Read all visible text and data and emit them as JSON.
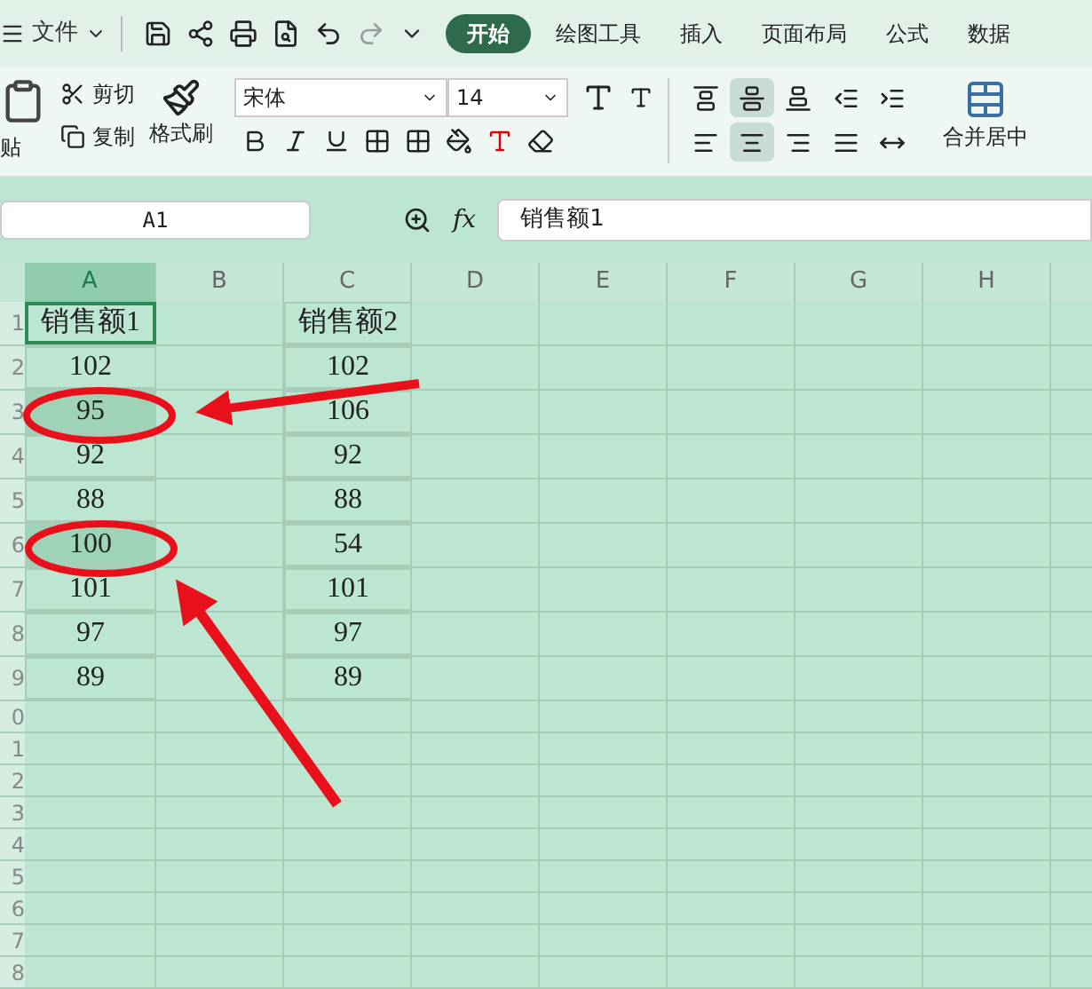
{
  "menu": {
    "label": "文件"
  },
  "tabs": [
    {
      "label": "开始",
      "selected": true
    },
    {
      "label": "绘图工具",
      "selected": false
    },
    {
      "label": "插入",
      "selected": false
    },
    {
      "label": "页面布局",
      "selected": false
    },
    {
      "label": "公式",
      "selected": false
    },
    {
      "label": "数据",
      "selected": false
    }
  ],
  "ribbon": {
    "paste": "贴",
    "cut": "剪切",
    "copy": "复制",
    "format_painter": "格式刷",
    "font": "宋体",
    "size": "14",
    "merge": "合并居中",
    "align_buttons": [
      {
        "kind": "top",
        "selected": false
      },
      {
        "kind": "middle",
        "selected": true
      },
      {
        "kind": "bottom",
        "selected": false
      },
      {
        "kind": "outdent",
        "selected": false
      },
      {
        "kind": "indent",
        "selected": false
      },
      {
        "kind": "left",
        "selected": false
      },
      {
        "kind": "center",
        "selected": true
      },
      {
        "kind": "right",
        "selected": false
      },
      {
        "kind": "justify",
        "selected": false
      },
      {
        "kind": "distributed",
        "selected": false
      }
    ]
  },
  "name_box": "A1",
  "fx": "fx",
  "formula": "销售额1",
  "columns": [
    {
      "label": "A",
      "selected": true
    },
    {
      "label": "B",
      "selected": false
    },
    {
      "label": "C",
      "selected": false
    },
    {
      "label": "D",
      "selected": false
    },
    {
      "label": "E",
      "selected": false
    },
    {
      "label": "F",
      "selected": false
    },
    {
      "label": "G",
      "selected": false
    },
    {
      "label": "H",
      "selected": false
    }
  ],
  "rows": [
    {
      "header": "1",
      "a": {
        "text": "销售额1",
        "selected": true
      },
      "c": "销售额2"
    },
    {
      "header": "2",
      "a": {
        "text": "102",
        "selected": false
      },
      "c": "102"
    },
    {
      "header": "3",
      "a": {
        "text": "95",
        "selected": true
      },
      "c": "106"
    },
    {
      "header": "4",
      "a": {
        "text": "92",
        "selected": false
      },
      "c": "92"
    },
    {
      "header": "5",
      "a": {
        "text": "88",
        "selected": false
      },
      "c": "88"
    },
    {
      "header": "6",
      "a": {
        "text": "100",
        "selected": true
      },
      "c": "54"
    },
    {
      "header": "7",
      "a": {
        "text": "101",
        "selected": false
      },
      "c": "101"
    },
    {
      "header": "8",
      "a": {
        "text": "97",
        "selected": false
      },
      "c": "97"
    },
    {
      "header": "9",
      "a": {
        "text": "89",
        "selected": false
      },
      "c": "89"
    },
    {
      "header": "0"
    },
    {
      "header": "1"
    },
    {
      "header": "2"
    },
    {
      "header": "3"
    },
    {
      "header": "4"
    },
    {
      "header": "5"
    },
    {
      "header": "6"
    },
    {
      "header": "7"
    },
    {
      "header": "8"
    }
  ]
}
